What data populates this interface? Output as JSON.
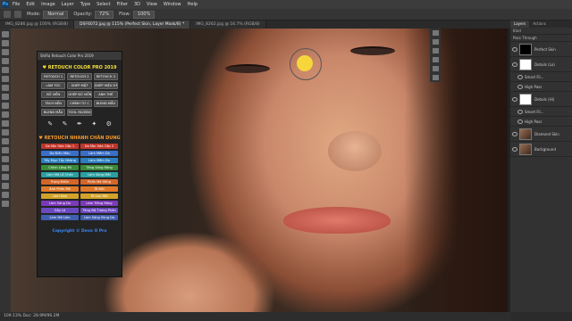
{
  "menu": {
    "items": [
      "File",
      "Edit",
      "Image",
      "Layer",
      "Type",
      "Select",
      "Filter",
      "3D",
      "View",
      "Window",
      "Help"
    ]
  },
  "options": {
    "mode_label": "Mode:",
    "mode_value": "Normal",
    "opacity_label": "Opacity:",
    "opacity_value": "72%",
    "flow_label": "Flow:",
    "flow_value": "100%"
  },
  "tabs": [
    {
      "label": "IMG_8286.jpg @ 100% (RGB/8)"
    },
    {
      "label": "DSF6072.jpg @ 115% (Perfect Skin, Layer Mask/8) *"
    },
    {
      "label": "IMG_8262.jpg @ 16.7% (RGB/8)"
    }
  ],
  "plugin": {
    "header": "ShiRa Retouch Color Pro 2019",
    "section1_title": "♥ RETOUCH COLOR PRO 2019",
    "section1_buttons": [
      {
        "label": "RETOUCH 1",
        "color": "#4a4a4a"
      },
      {
        "label": "RETOUCH 2",
        "color": "#4a4a4a"
      },
      {
        "label": "RETOUCH 3",
        "color": "#4a4a4a"
      },
      {
        "label": "LÀM TÓC",
        "color": "#4a4a4a"
      },
      {
        "label": "GHÉP MẶT",
        "color": "#4a4a4a"
      },
      {
        "label": "GHÉP HIỆU ỨNG",
        "color": "#4a4a4a"
      },
      {
        "label": "BỎ VIỀN",
        "color": "#4a4a4a"
      },
      {
        "label": "GHÉP BỐ VIỀN",
        "color": "#4a4a4a"
      },
      {
        "label": "ANH THẺ",
        "color": "#4a4a4a"
      },
      {
        "label": "TÁCH NỀN",
        "color": "#4a4a4a"
      },
      {
        "label": "CHỈNH TỪ C",
        "color": "#4a4a4a"
      },
      {
        "label": "BLEND MẪU",
        "color": "#4a4a4a"
      },
      {
        "label": "BLEND MẪU",
        "color": "#4a4a4a"
      },
      {
        "label": "TOOL FACEBOOK/WEB",
        "color": "#4a4a4a"
      }
    ],
    "icons": [
      "brush-icon",
      "brush-icon",
      "pen-icon",
      "wand-icon",
      "settings-icon"
    ],
    "section2_title": "♥ RETOUCH NHANH CHÂN DUNG",
    "section2_buttons": [
      {
        "label": "Da Mịn Hóa Cấp 1",
        "color": "#c0352b"
      },
      {
        "label": "Da Mịn Hóa Cấp 2",
        "color": "#c0352b"
      },
      {
        "label": "Da Điều Màu",
        "color": "#3a6fc8"
      },
      {
        "label": "Làm Mềm Da",
        "color": "#3a6fc8"
      },
      {
        "label": "Tẩy Mụn Tẩy Nhăng",
        "color": "#2b7fc0"
      },
      {
        "label": "Làm Mềm Da",
        "color": "#2b7fc0"
      },
      {
        "label": "Chỉnh Lông Mi",
        "color": "#3a8a3a"
      },
      {
        "label": "Tăng Sáng Răng",
        "color": "#3a8a3a"
      },
      {
        "label": "Làm Mờ Lỗ Chân",
        "color": "#2aa0a0"
      },
      {
        "label": "Làm Sáng Mắt",
        "color": "#2aa0a0"
      },
      {
        "label": "Trang Điểm",
        "color": "#d4662a"
      },
      {
        "label": "Phấn Má Hồng",
        "color": "#d4662a"
      },
      {
        "label": "Ánh Phản Má",
        "color": "#e07a2a"
      },
      {
        "label": "Tô Môi",
        "color": "#e07a2a"
      },
      {
        "label": "Làm Đẹp",
        "color": "#d2a32a"
      },
      {
        "label": "Tô Son Môi",
        "color": "#d2a32a"
      },
      {
        "label": "Làm Sáng Da",
        "color": "#7b3ab8"
      },
      {
        "label": "Làm Trắng Răng",
        "color": "#7b3ab8"
      },
      {
        "label": "Gầy Lõ",
        "color": "#6a4ac0"
      },
      {
        "label": "Tăng Độ Tương Phản",
        "color": "#6a4ac0"
      },
      {
        "label": "Làm Mờ Lõm",
        "color": "#3f5fb0"
      },
      {
        "label": "Làm Sáng Vùng Da",
        "color": "#3f5fb0"
      }
    ],
    "copyright": "Copyright © Dovo O Pro"
  },
  "layers_panel": {
    "tabs": [
      "Layers",
      "Actions"
    ],
    "kind_label": "Kind",
    "blend_label": "Pass Through",
    "layers": [
      {
        "name": "Perfect Skin",
        "thumb": "black",
        "sub": false
      },
      {
        "name": "Details (Lo)",
        "thumb": "white",
        "sub": false
      },
      {
        "name": "Smart Fil...",
        "thumb": "none",
        "sub": true
      },
      {
        "name": "High Pass",
        "thumb": "none",
        "sub": true
      },
      {
        "name": "Details (Hi)",
        "thumb": "white",
        "sub": false
      },
      {
        "name": "Smart Fil...",
        "thumb": "none",
        "sub": true
      },
      {
        "name": "High Pass",
        "thumb": "none",
        "sub": true
      },
      {
        "name": "Diamond Skin",
        "thumb": "photo",
        "sub": false
      },
      {
        "name": "Background",
        "thumb": "photo",
        "sub": false
      }
    ]
  },
  "status": {
    "text": "109.13%    Doc: 28.9M/96.2M"
  }
}
